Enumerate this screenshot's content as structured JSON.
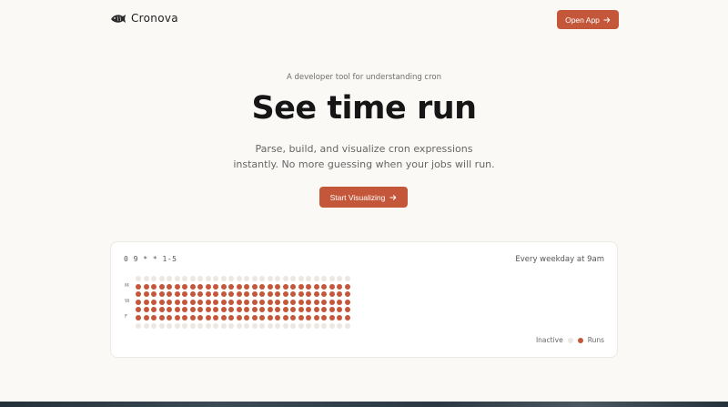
{
  "header": {
    "brand": "Cronova",
    "open_app_label": "Open App"
  },
  "hero": {
    "tagline": "A developer tool for understanding cron",
    "title": "See time run",
    "subtitle_line1": "Parse, build, and visualize cron expressions",
    "subtitle_line2": "instantly. No more guessing when your jobs will run.",
    "cta_label": "Start Visualizing"
  },
  "demo": {
    "expression": "0 9 * * 1-5",
    "description": "Every weekday at 9am",
    "day_labels": [
      "M",
      "W",
      "F"
    ],
    "columns": 28,
    "active_rows": [
      1,
      2,
      3,
      4,
      5
    ],
    "total_rows": 7,
    "legend_inactive": "Inactive",
    "legend_runs": "Runs"
  },
  "colors": {
    "accent": "#c4573a",
    "inactive_dot": "#ece8e1",
    "background": "#fbf9f5"
  },
  "icons": {
    "logo": "fish-logo-icon",
    "open_app_arrow": "arrow-right-icon",
    "cta_arrow": "arrow-right-icon"
  }
}
